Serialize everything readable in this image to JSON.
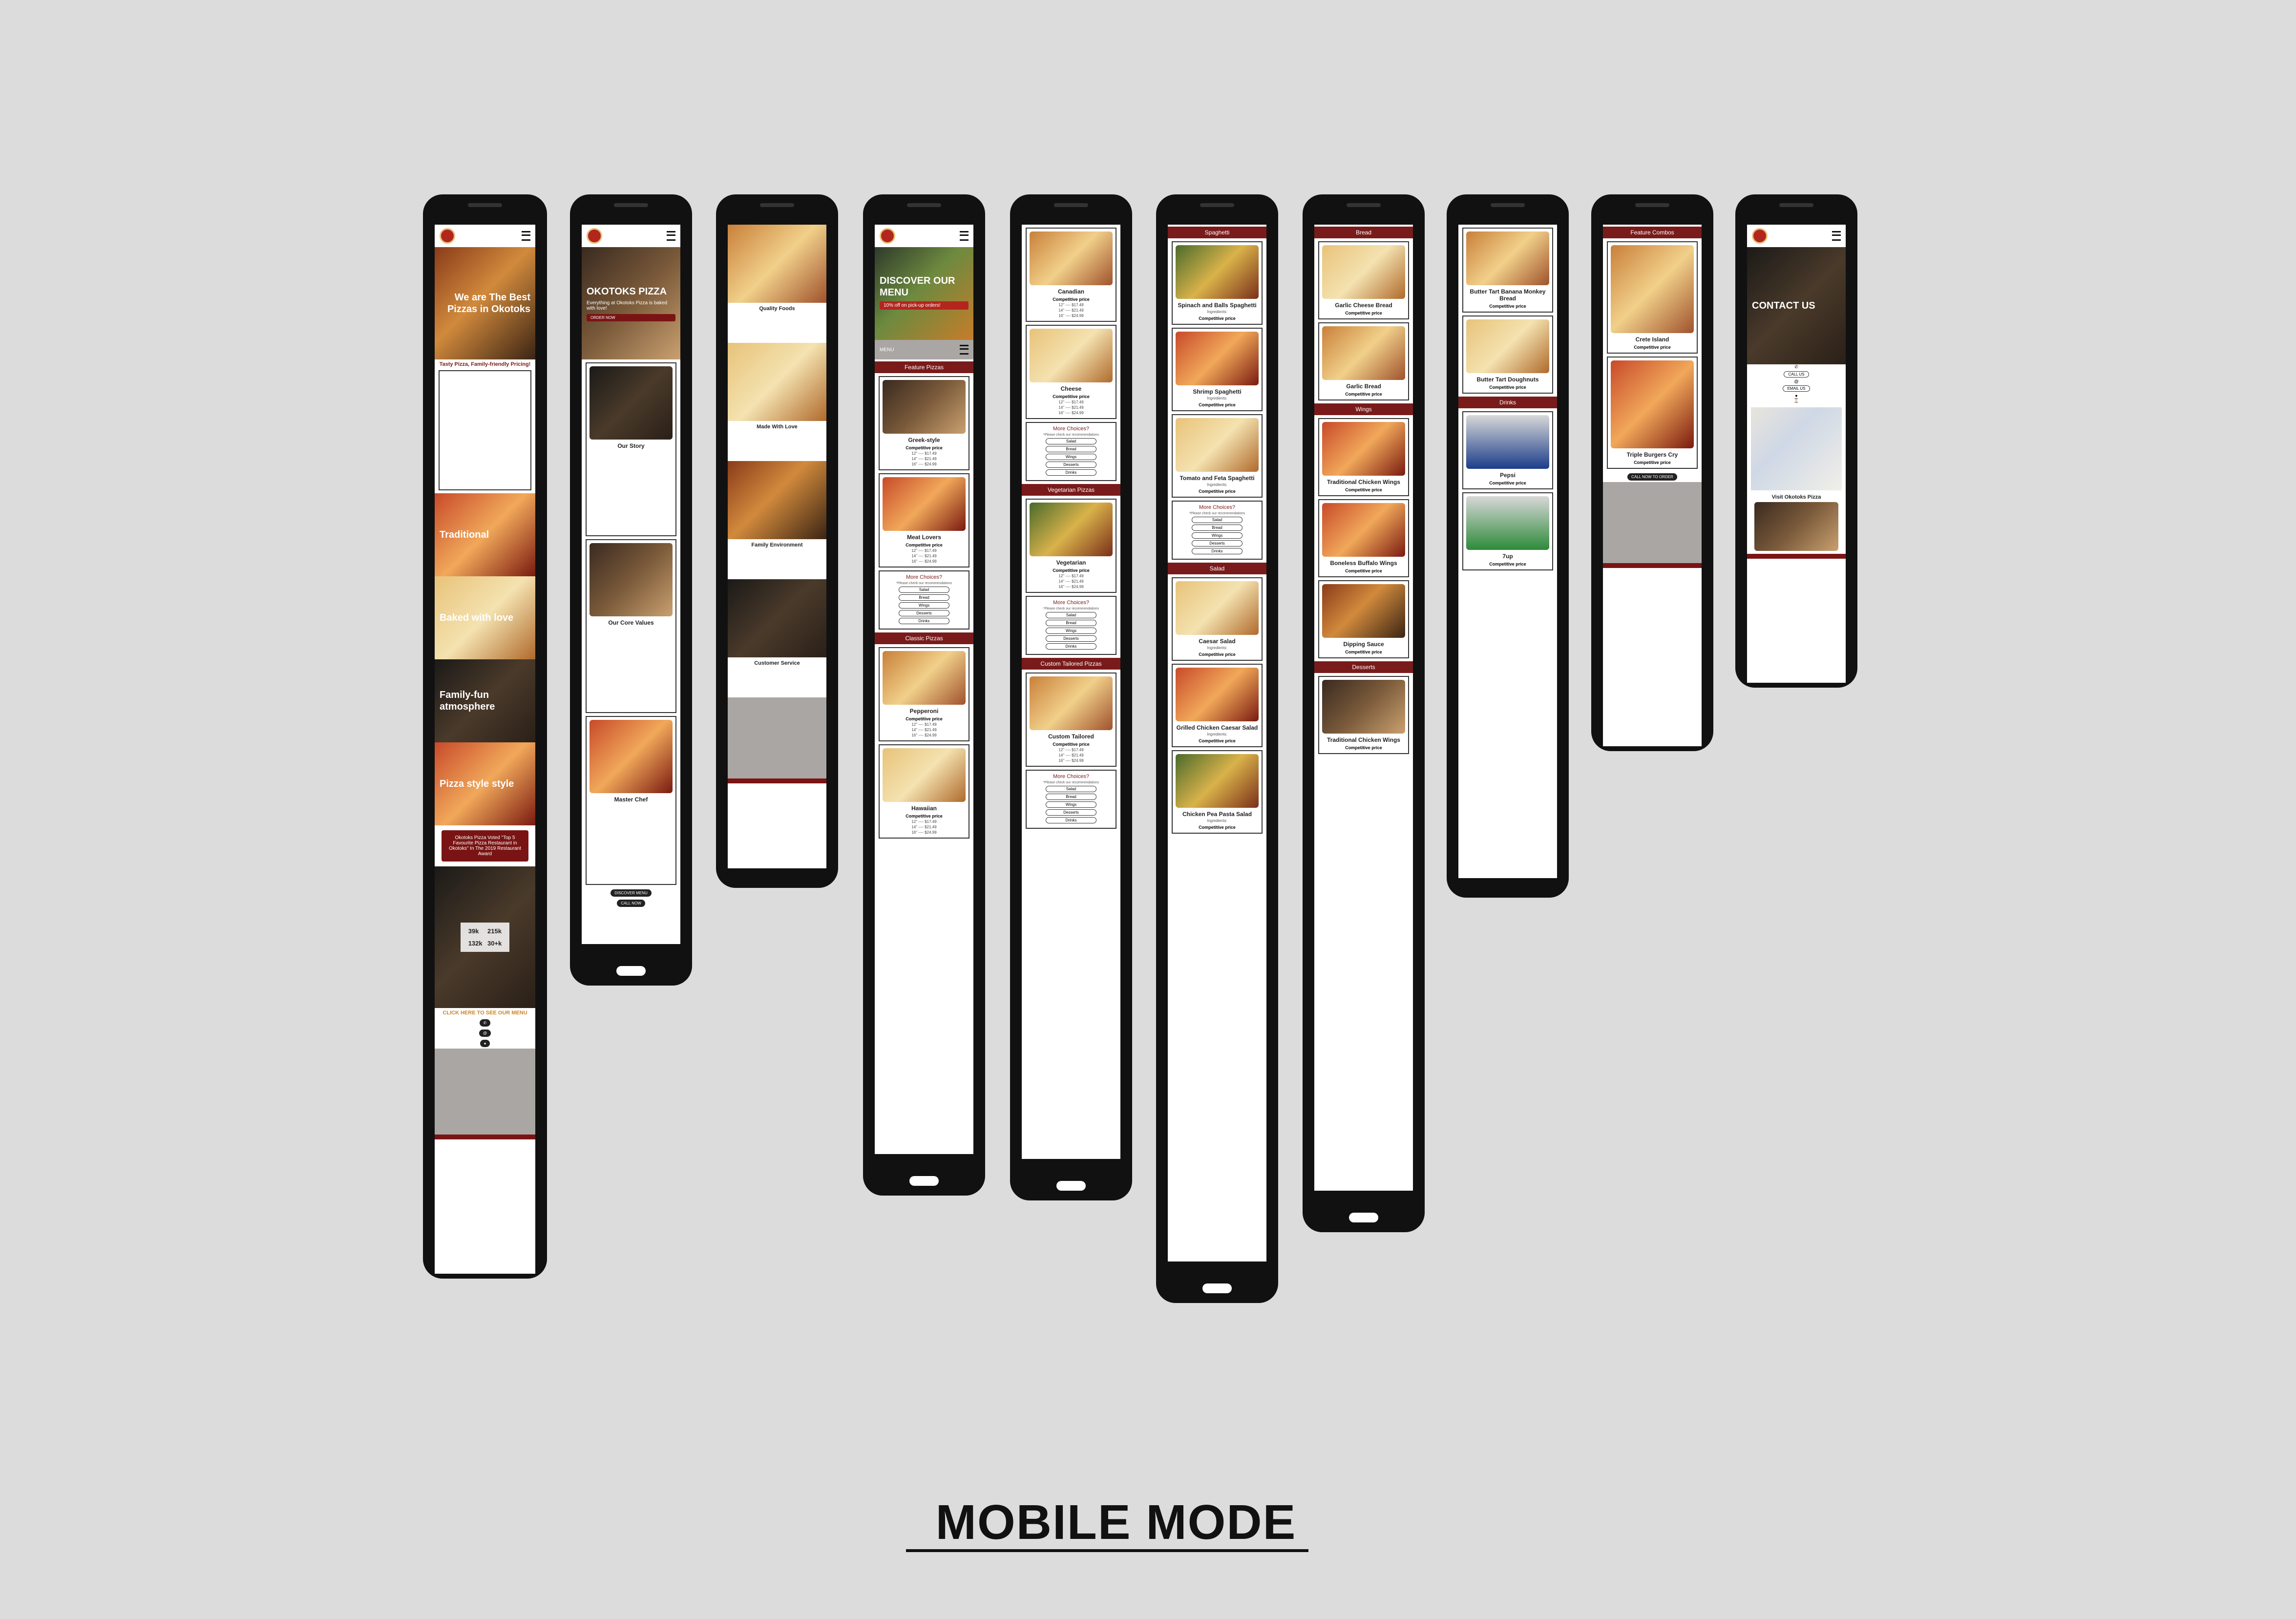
{
  "caption": "MOBILE MODE",
  "common": {
    "competitive": "Competitive price",
    "ingredients": "Ingredients:",
    "more_title": "More Choices?",
    "more_sub": "*Please check our recommendations",
    "choices": [
      "Salad",
      "Bread",
      "Wings",
      "Desserts",
      "Drinks"
    ],
    "sizes": [
      "12\" ---- $17.49",
      "14\" ---- $21.49",
      "16\" ---- $24.99"
    ]
  },
  "p1": {
    "hero": "We are The Best Pizzas in Okotoks",
    "tag": "Tasty Pizza, Family-friendly Pricing!",
    "tiles": [
      "Traditional",
      "Baked with love",
      "Family-fun atmosphere",
      "Pizza style style"
    ],
    "award": "Okotoks Pizza Voted \"Top 5 Favourite Pizza Restaurant in Okotoks\" In The 2019 Restaurant Award",
    "stats": [
      "39k",
      "215k",
      "132k",
      "30+k"
    ],
    "menu_link": "CLICK HERE TO SEE OUR MENU"
  },
  "p2": {
    "hero_title": "OKOTOKS PIZZA",
    "hero_sub": "Everything at Okotoks Pizza is baked with love!",
    "order": "ORDER NOW",
    "sections": [
      "Our Story",
      "Our Core Values",
      "Master Chef"
    ]
  },
  "p3": {
    "features": [
      "Quality Foods",
      "Made With Love",
      "Family Environment",
      "Customer Service"
    ]
  },
  "p4": {
    "hero_title": "DISCOVER OUR MENU",
    "hero_sub": "10% off on pick-up orders!",
    "menu": "MENU",
    "feature_head": "Feature Pizzas",
    "classic_head": "Classic Pizzas",
    "items": [
      "Greek-style",
      "Meat Lovers",
      "Pepperoni",
      "Hawaiian"
    ]
  },
  "p5": {
    "items": [
      "Canadian",
      "Cheese"
    ],
    "veg_head": "Vegetarian Pizzas",
    "veg_item": "Vegetarian",
    "custom_head": "Custom Tailored Pizzas",
    "custom_item": "Custom Tailored"
  },
  "p6": {
    "spag_head": "Spaghetti",
    "spag_items": [
      "Spinach and Balls Spaghetti",
      "Shrimp Spaghetti",
      "Tomato and Feta Spaghetti"
    ],
    "salad_head": "Salad",
    "salad_items": [
      "Caesar Salad",
      "Grilled Chicken Caesar Salad",
      "Chicken Pea Pasta Salad"
    ]
  },
  "p7": {
    "bread_head": "Bread",
    "bread_items": [
      "Garlic Cheese Bread",
      "Garlic Bread"
    ],
    "wings_head": "Wings",
    "wings_items": [
      "Traditional Chicken Wings",
      "Boneless Buffalo Wings",
      "Dipping Sauce"
    ],
    "dess_head": "Desserts",
    "dess_item": "Traditional Chicken Wings"
  },
  "p8": {
    "items": [
      "Butter Tart Banana Monkey Bread",
      "Butter Tart Doughnuts"
    ],
    "drinks_head": "Drinks",
    "drinks": [
      "Pepsi",
      "7up"
    ]
  },
  "p9": {
    "head": "Feature Combos",
    "items": [
      "Crete Island",
      "Triple Burgers Cry"
    ],
    "call": "CALL NOW TO ORDER"
  },
  "p10": {
    "hero": "CONTACT US",
    "buttons": [
      "CALL US",
      "EMAIL US"
    ],
    "visit": "Visit Okotoks Pizza"
  }
}
